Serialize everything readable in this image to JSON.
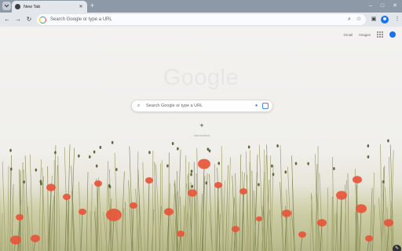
{
  "browser": {
    "tab_title": "New Tab",
    "new_tab_symbol": "+",
    "window_controls": {
      "minimize": "–",
      "maximize": "□",
      "close": "✕"
    },
    "omnibox_placeholder": "Search Google or type a URL"
  },
  "toolbar_icons": [
    "back-arrow-icon",
    "forward-arrow-icon",
    "reload-icon",
    "zoom-icon",
    "bookmark-star-icon",
    "side-panel-icon",
    "profile-icon",
    "kebab-menu-icon"
  ],
  "ntp": {
    "links": {
      "gmail": "Gmail",
      "images": "Images"
    },
    "logo": "Google",
    "search_placeholder": "Search Google or type a URL",
    "shortcut": {
      "symbol": "+",
      "label": "Add shortcut"
    },
    "customize_icon": "pencil-icon"
  },
  "colors": {
    "tabstrip": "#8d99a6",
    "toolbar": "#e3e6ea",
    "accent_blue": "#1a73e8",
    "poppy_red": "#e8553a"
  }
}
